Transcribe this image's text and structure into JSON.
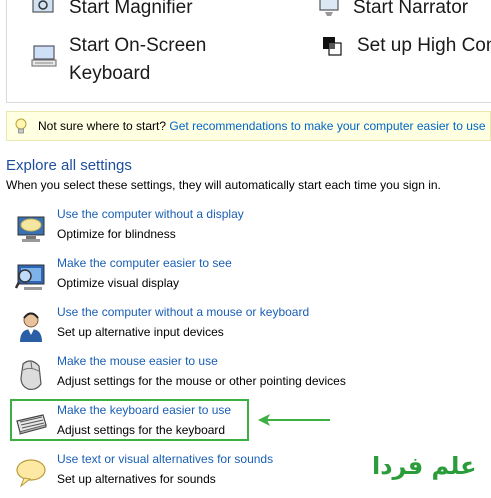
{
  "quick_access": {
    "magnifier": "Start Magnifier",
    "narrator": "Start Narrator",
    "onscreen_keyboard_line1": "Start On-Screen",
    "onscreen_keyboard_line2": "Keyboard",
    "high_contrast": "Set up High Con"
  },
  "tip": {
    "prefix": "Not sure where to start?",
    "link": "Get recommendations to make your computer easier to use"
  },
  "explore": {
    "title": "Explore all settings",
    "description": "When you select these settings, they will automatically start each time you sign in."
  },
  "settings": [
    {
      "link": "Use the computer without a display",
      "desc": "Optimize for blindness",
      "icon": "display-icon"
    },
    {
      "link": "Make the computer easier to see",
      "desc": "Optimize visual display",
      "icon": "magnifier-monitor-icon"
    },
    {
      "link": "Use the computer without a mouse or keyboard",
      "desc": "Set up alternative input devices",
      "icon": "headset-person-icon"
    },
    {
      "link": "Make the mouse easier to use",
      "desc": "Adjust settings for the mouse or other pointing devices",
      "icon": "mouse-icon"
    },
    {
      "link": "Make the keyboard easier to use",
      "desc": "Adjust settings for the keyboard",
      "icon": "keyboard-icon"
    },
    {
      "link": "Use text or visual alternatives for sounds",
      "desc": "Set up alternatives for sounds",
      "icon": "speech-bubble-icon"
    }
  ],
  "watermark": "علم فردا",
  "colors": {
    "link": "#1a5fb4",
    "highlight": "#3cb043",
    "tip_background": "#ffffe1"
  }
}
